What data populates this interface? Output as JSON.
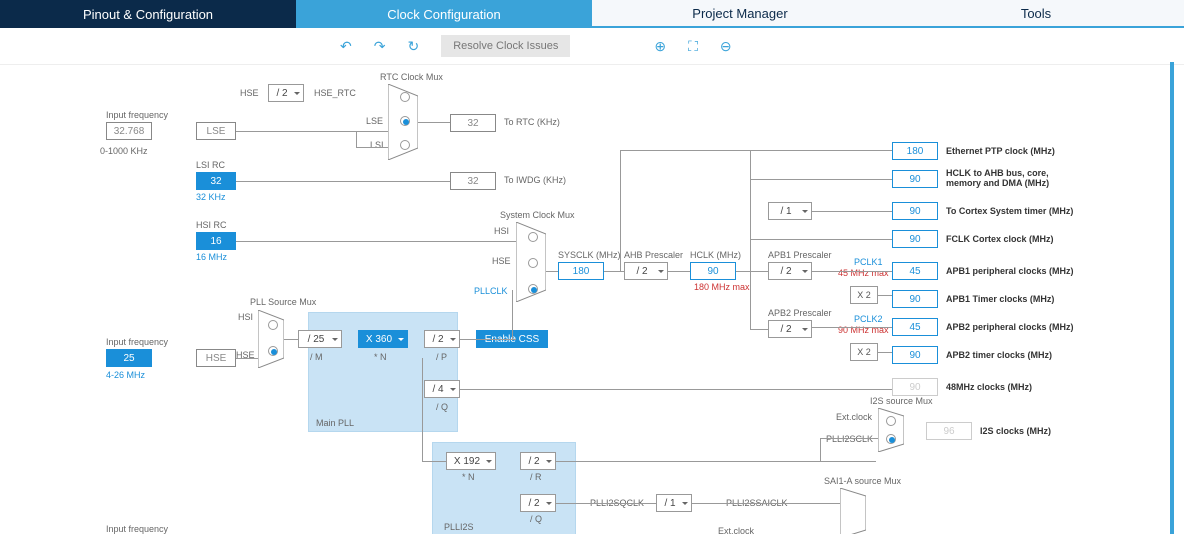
{
  "tabs": {
    "pinout": "Pinout & Configuration",
    "clock": "Clock Configuration",
    "project": "Project Manager",
    "tools": "Tools"
  },
  "toolbar": {
    "resolve": "Resolve Clock Issues"
  },
  "inputs": {
    "lse_label": "Input frequency",
    "lse_val": "32.768",
    "lse_range": "0-1000 KHz",
    "lse_name": "LSE",
    "lsi_name": "LSI RC",
    "lsi_val": "32",
    "lsi_hz": "32 KHz",
    "hsi_name": "HSI RC",
    "hsi_val": "16",
    "hsi_hz": "16 MHz",
    "hse_label": "Input frequency",
    "hse_val": "25",
    "hse_range": "4-26 MHz",
    "hse_name": "HSE",
    "bot_label": "Input frequency"
  },
  "hse_div": {
    "sel": "/ 2",
    "tag": "HSE_RTC",
    "src": "HSE"
  },
  "rtc": {
    "title": "RTC Clock Mux",
    "lse": "LSE",
    "lsi": "LSI",
    "to_rtc": "To RTC (KHz)",
    "to_iwdg": "To IWDG (KHz)",
    "rtc_val": "32",
    "iwdg_val": "32"
  },
  "pll": {
    "title": "PLL Source Mux",
    "hsi": "HSI",
    "hse": "HSE",
    "main": "Main PLL",
    "m_sel": "/ 25",
    "m": "/ M",
    "n_sel": "X 360",
    "n": "* N",
    "p_sel": "/ 2",
    "p": "/ P",
    "q_sel": "/ 4",
    "q": "/ Q",
    "css": "Enable CSS"
  },
  "pll2": {
    "title": "PLLI2S",
    "n_sel": "X 192",
    "n": "* N",
    "r_sel": "/ 2",
    "r": "/ R",
    "q_sel": "/ 2",
    "q": "/ Q",
    "qclk": "PLLI2SQCLK",
    "qdiv": "/ 1",
    "sclk": "PLLI2SCLK",
    "saiclk": "PLLI2SSAICLK"
  },
  "sys": {
    "title": "System Clock Mux",
    "hsi": "HSI",
    "hse": "HSE",
    "pllclk": "PLLCLK",
    "sysclk": "SYSCLK (MHz)",
    "sysclk_val": "180"
  },
  "ahb": {
    "label": "AHB Prescaler",
    "sel": "/ 2",
    "hclk": "HCLK (MHz)",
    "hclk_val": "90",
    "max": "180 MHz max"
  },
  "apb1": {
    "label": "APB1 Prescaler",
    "sel": "/ 2",
    "pclk": "PCLK1",
    "max": "45 MHz max",
    "x2": "X 2"
  },
  "apb2": {
    "label": "APB2 Prescaler",
    "sel": "/ 2",
    "pclk": "PCLK2",
    "max": "90 MHz max",
    "x2": "X 2"
  },
  "cortex": {
    "sel": "/ 1"
  },
  "i2s": {
    "title": "I2S source Mux",
    "ext": "Ext.clock",
    "val": "96",
    "label": "I2S clocks (MHz)"
  },
  "sai": {
    "title": "SAI1-A source Mux",
    "ext": "Ext.clock"
  },
  "out": [
    {
      "v": "180",
      "l": "Ethernet PTP clock (MHz)"
    },
    {
      "v": "90",
      "l": "HCLK to AHB bus, core, memory and DMA (MHz)"
    },
    {
      "v": "90",
      "l": "To Cortex System timer (MHz)"
    },
    {
      "v": "90",
      "l": "FCLK Cortex clock (MHz)"
    },
    {
      "v": "45",
      "l": "APB1 peripheral clocks (MHz)"
    },
    {
      "v": "90",
      "l": "APB1 Timer clocks (MHz)"
    },
    {
      "v": "45",
      "l": "APB2 peripheral clocks (MHz)"
    },
    {
      "v": "90",
      "l": "APB2 timer clocks (MHz)"
    },
    {
      "v": "90",
      "l": "48MHz clocks (MHz)"
    }
  ]
}
